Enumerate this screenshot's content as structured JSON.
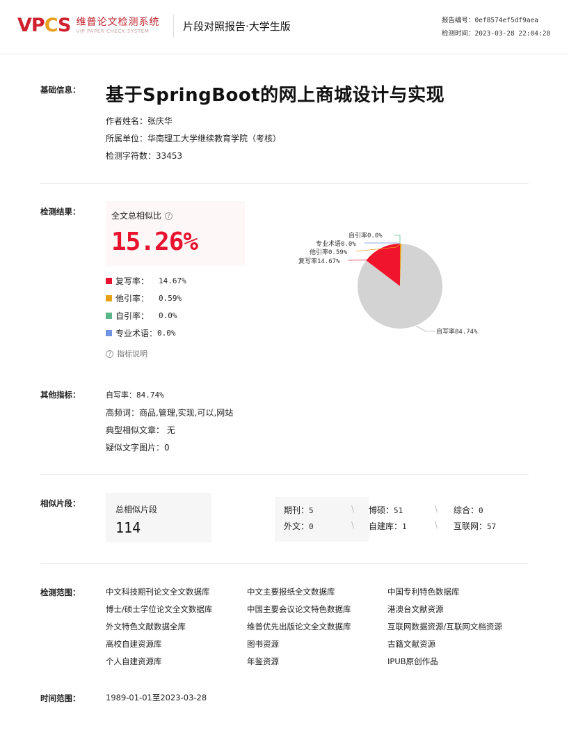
{
  "header": {
    "logo_mark": [
      "V",
      "P",
      "C",
      "S"
    ],
    "logo_cn": "维普论文检测系统",
    "logo_en": "VIP PAPER CHECK SYSTEM",
    "report_name": "片段对照报告·大学生版",
    "report_no_label": "报告编号：",
    "report_no": "0ef8574ef5df9aea",
    "check_time_label": "检测时间：",
    "check_time": "2023-03-28 22:04:28"
  },
  "basic": {
    "label": "基础信息：",
    "title": "基于SpringBoot的网上商城设计与实现",
    "author": "作者姓名：张庆华",
    "unit": "所属单位：华南理工大学继续教育学院（考核）",
    "chars": "检测字符数：33453"
  },
  "result": {
    "label": "检测结果：",
    "overall_label": "全文总相似比",
    "overall_value": "15.26%",
    "legend": [
      {
        "name": "复写率：",
        "value": "14.67%",
        "color": "#e8132e"
      },
      {
        "name": "他引率：",
        "value": "0.59%",
        "color": "#e8a31a"
      },
      {
        "name": "自引率：",
        "value": "0.0%",
        "color": "#5cb88a"
      },
      {
        "name": "专业术语：",
        "value": "0.0%",
        "color": "#6f93e0"
      }
    ],
    "help": "指标说明",
    "pie_labels": {
      "self_cite": "自引率0.0%",
      "terms": "专业术语0.0%",
      "other_cite": "他引率0.59%",
      "rewrite": "复写率14.67%",
      "self_written": "自写率84.74%"
    }
  },
  "chart_data": {
    "type": "pie",
    "categories": [
      "复写率",
      "他引率",
      "自引率",
      "专业术语",
      "自写率"
    ],
    "values": [
      14.67,
      0.59,
      0.0,
      0.0,
      84.74
    ],
    "colors": [
      "#f0152c",
      "#e8a31a",
      "#5cb88a",
      "#6f93e0",
      "#d3d3d3"
    ]
  },
  "other": {
    "label": "其他指标：",
    "self_written": "自写率：84.74%",
    "high_freq": "高频词：商品,管理,实现,可以,网站",
    "typical": "典型相似文章： 无",
    "suspect_images": "疑似文字图片：0"
  },
  "segments": {
    "label": "相似片段：",
    "total_label": "总相似片段",
    "total": "114",
    "items": [
      {
        "name": "期刊：",
        "value": "5"
      },
      {
        "name": "博硕：",
        "value": "51"
      },
      {
        "name": "综合：",
        "value": "0"
      },
      {
        "name": "外文：",
        "value": "0"
      },
      {
        "name": "自建库：",
        "value": "1"
      },
      {
        "name": "互联网：",
        "value": "57"
      }
    ],
    "sep": "\\"
  },
  "scope": {
    "label": "检测范围：",
    "col1": [
      "中文科技期刊论文全文数据库",
      "博士/硕士学位论文全文数据库",
      "外文特色文献数据全库",
      "高校自建资源库",
      "个人自建资源库"
    ],
    "col2": [
      "中文主要报纸全文数据库",
      "中国主要会议论文特色数据库",
      "维普优先出版论文全文数据库",
      "图书资源",
      "年鉴资源"
    ],
    "col3": [
      "中国专利特色数据库",
      "港澳台文献资源",
      "互联网数据资源/互联网文档资源",
      "古籍文献资源",
      "IPUB原创作品"
    ]
  },
  "time": {
    "label": "时间范围：",
    "value": "1989-01-01至2023-03-28"
  }
}
